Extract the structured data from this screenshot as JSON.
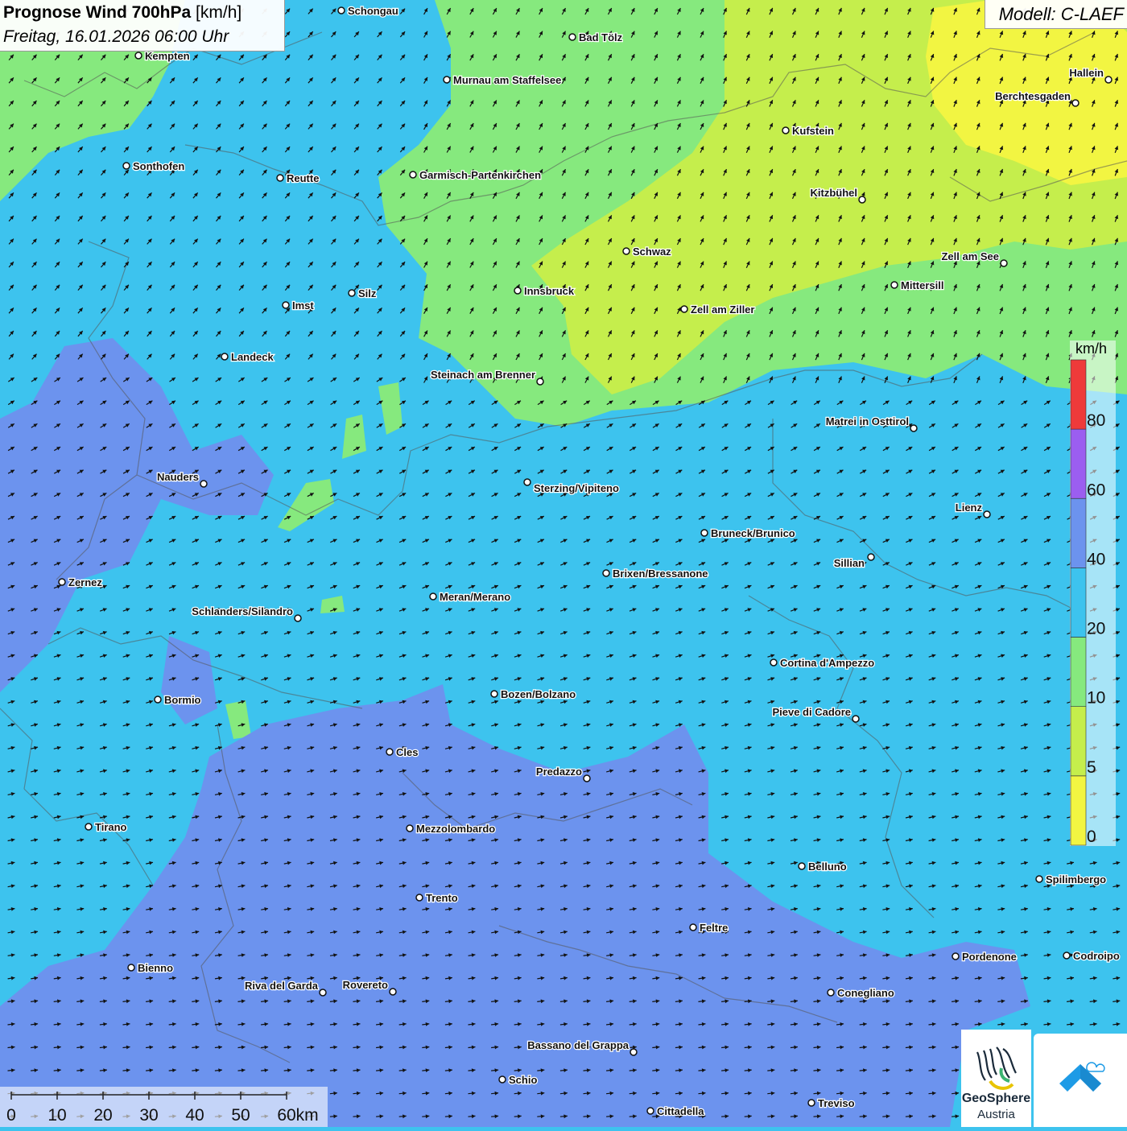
{
  "header": {
    "title_bold": "Prognose Wind 700hPa",
    "title_unit": "[km/h]",
    "datetime": "Freitag, 16.01.2026 06:00 Uhr",
    "model": "Modell: C-LAEF"
  },
  "legend": {
    "unit": "km/h",
    "ticks": [
      "0",
      "5",
      "10",
      "20",
      "40",
      "60",
      "80"
    ],
    "colors": [
      "#f2f542",
      "#c5ee4c",
      "#86e97e",
      "#3dc3ee",
      "#6c93ee",
      "#9b5ef0",
      "#ee3a3a"
    ]
  },
  "scale_bar": {
    "labels": [
      "0",
      "10",
      "20",
      "30",
      "40",
      "50",
      "60km"
    ]
  },
  "logo": {
    "name_line1": "GeoSphere",
    "name_line2": "Austria",
    "icon": "geosphere-logo-icon",
    "app_icon": "weather-app-icon"
  },
  "places": [
    {
      "name": "Schongau"
    },
    {
      "name": "Bad Tölz"
    },
    {
      "name": "Kempten"
    },
    {
      "name": "Murnau am Staffelsee"
    },
    {
      "name": "Hallein"
    },
    {
      "name": "Berchtesgaden"
    },
    {
      "name": "Kufstein"
    },
    {
      "name": "Sonthofen"
    },
    {
      "name": "Reutte"
    },
    {
      "name": "Garmisch-Partenkirchen"
    },
    {
      "name": "Kitzbühel"
    },
    {
      "name": "Schwaz"
    },
    {
      "name": "Zell am See"
    },
    {
      "name": "Mittersill"
    },
    {
      "name": "Innsbruck"
    },
    {
      "name": "Silz"
    },
    {
      "name": "Imst"
    },
    {
      "name": "Zell am Ziller"
    },
    {
      "name": "Landeck"
    },
    {
      "name": "Steinach am Brenner"
    },
    {
      "name": "Matrei in Osttirol"
    },
    {
      "name": "Nauders"
    },
    {
      "name": "Sterzing/Vipiteno"
    },
    {
      "name": "Lienz"
    },
    {
      "name": "Bruneck/Brunico"
    },
    {
      "name": "Sillian"
    },
    {
      "name": "Zernez"
    },
    {
      "name": "Brixen/Bressanone"
    },
    {
      "name": "Meran/Merano"
    },
    {
      "name": "Schlanders/Silandro"
    },
    {
      "name": "Cortina d'Ampezzo"
    },
    {
      "name": "Bozen/Bolzano"
    },
    {
      "name": "Bormio"
    },
    {
      "name": "Pieve di Cadore"
    },
    {
      "name": "Cles"
    },
    {
      "name": "Predazzo"
    },
    {
      "name": "Tirano"
    },
    {
      "name": "Mezzolombardo"
    },
    {
      "name": "Belluno"
    },
    {
      "name": "Spilimbergo"
    },
    {
      "name": "Trento"
    },
    {
      "name": "Feltre"
    },
    {
      "name": "Bienno"
    },
    {
      "name": "Pordenone"
    },
    {
      "name": "Codroipo"
    },
    {
      "name": "Riva del Garda"
    },
    {
      "name": "Rovereto"
    },
    {
      "name": "Conegliano"
    },
    {
      "name": "Bassano del Grappa"
    },
    {
      "name": "Schio"
    },
    {
      "name": "Treviso"
    },
    {
      "name": "Cittadella"
    }
  ]
}
